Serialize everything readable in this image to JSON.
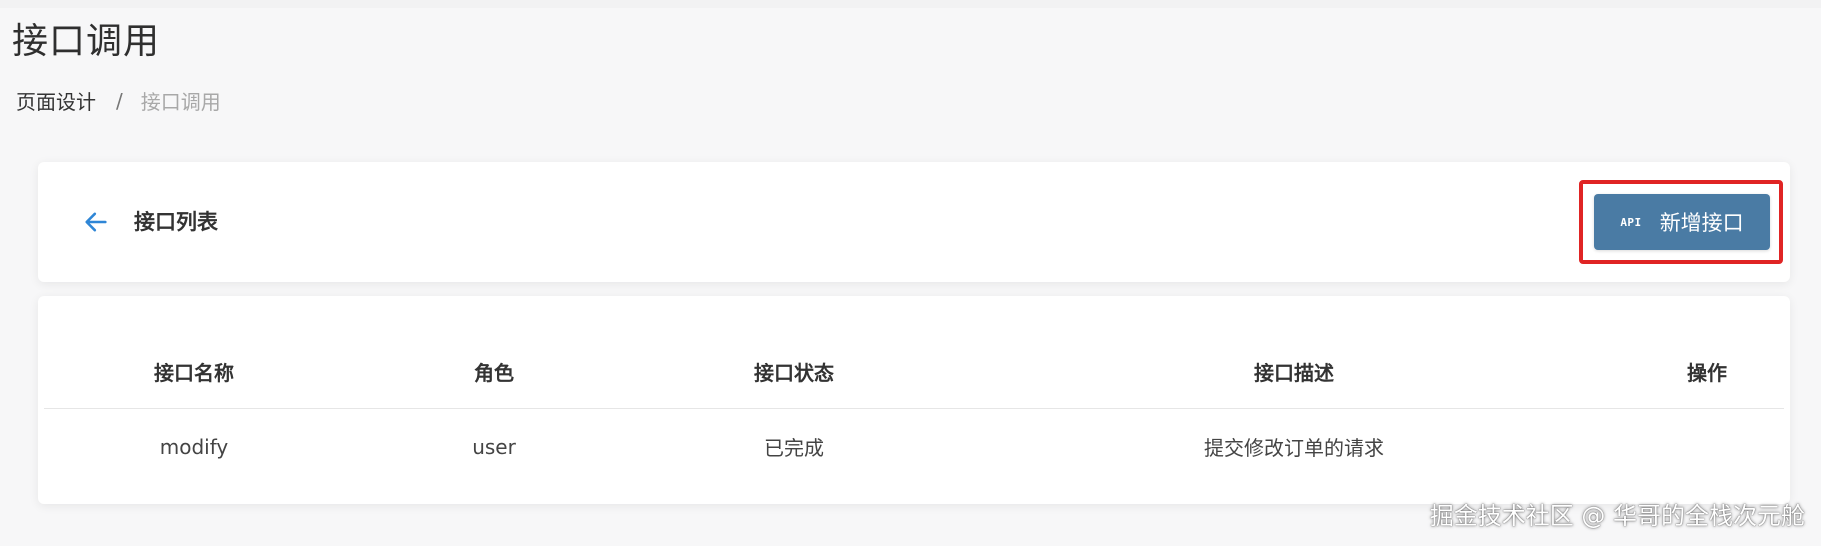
{
  "page": {
    "title": "接口调用"
  },
  "breadcrumb": {
    "parent": "页面设计",
    "separator": "/",
    "current": "接口调用"
  },
  "header": {
    "back_icon": "arrow-left-icon",
    "title": "接口列表",
    "add_button": {
      "icon_text": "API",
      "label": "新增接口",
      "color": "#4a7ba4"
    },
    "highlight_color": "#e02424"
  },
  "table": {
    "columns": [
      "接口名称",
      "角色",
      "接口状态",
      "接口描述",
      "操作"
    ],
    "rows": [
      {
        "name": "modify",
        "role": "user",
        "status": "已完成",
        "description": "提交修改订单的请求",
        "actions": ""
      }
    ]
  },
  "watermark": "掘金技术社区 @ 华哥的全栈次元舱"
}
